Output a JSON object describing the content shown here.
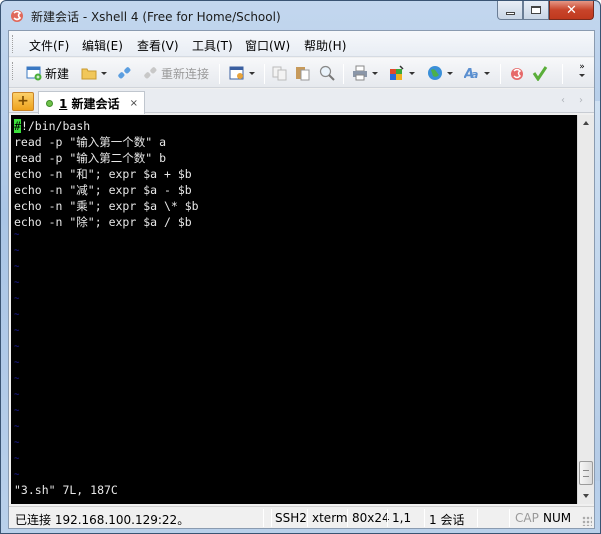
{
  "window": {
    "title": "新建会话 - Xshell 4 (Free for Home/School)",
    "controls": {
      "minimize": "minimize",
      "maximize": "maximize",
      "close": "✕"
    }
  },
  "menubar": {
    "items": [
      {
        "label": "文件(F)"
      },
      {
        "label": "编辑(E)"
      },
      {
        "label": "查看(V)"
      },
      {
        "label": "工具(T)"
      },
      {
        "label": "窗口(W)"
      },
      {
        "label": "帮助(H)"
      }
    ]
  },
  "toolbar": {
    "new_label": "新建",
    "reconnect_label": "重新连接",
    "icons": [
      "new-session-icon",
      "open-folder-icon",
      "connect-icon",
      "reconnect-icon",
      "properties-icon",
      "copy-icon",
      "paste-icon",
      "find-icon",
      "print-icon",
      "color-scheme-icon",
      "globe-icon",
      "font-icon",
      "xftp-icon",
      "xmanager-icon",
      "more-icon"
    ],
    "more_label": "»"
  },
  "tabs": {
    "new_tab_label": "+",
    "items": [
      {
        "number": "1",
        "label": "新建会话",
        "close": "×",
        "status_color": "#6fc24a"
      }
    ],
    "nav_prev": "‹",
    "nav_next": "›"
  },
  "terminal": {
    "cursor_char": "#",
    "lines": [
      "!/bin/bash",
      "read -p \"输入第一个数\" a",
      "read -p \"输入第二个数\" b",
      "echo -n \"和\"; expr $a + $b",
      "echo -n \"减\"; expr $a - $b",
      "echo -n \"乘\"; expr $a \\* $b",
      "echo -n \"除\"; expr $a / $b"
    ],
    "tilde": "~",
    "tilde_count": 16,
    "status_line": "\"3.sh\" 7L, 187C",
    "colors": {
      "background": "#000000",
      "text": "#e8e8e8",
      "cursor": "#3ce23c",
      "tilde": "#1e1ea8"
    }
  },
  "statusbar": {
    "connection": "已连接 192.168.100.129:22。",
    "protocol": "SSH2",
    "terminal_type": "xterm",
    "size": "80x24",
    "position": "1,1",
    "sessions": "1 会话",
    "cap": "CAP",
    "num": "NUM"
  }
}
